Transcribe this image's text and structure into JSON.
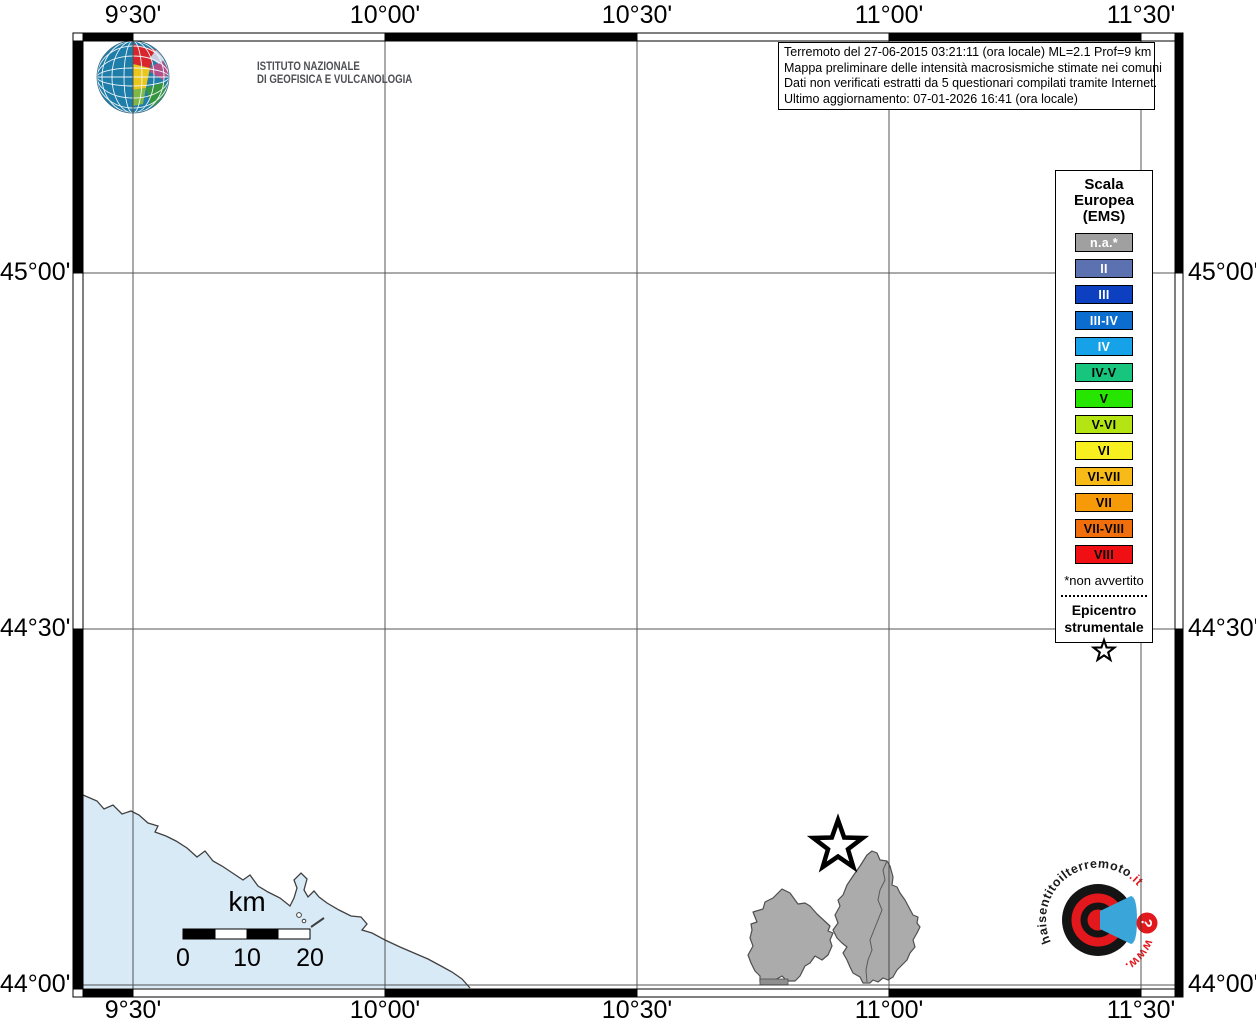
{
  "axes": {
    "top": [
      "9°30'",
      "10°00'",
      "10°30'",
      "11°00'",
      "11°30'"
    ],
    "bottom": [
      "9°30'",
      "10°00'",
      "10°30'",
      "11°00'",
      "11°30'"
    ],
    "left": [
      "45°00'",
      "44°30'",
      "44°00'"
    ],
    "right": [
      "45°00'",
      "44°30'",
      "44°00'"
    ]
  },
  "branding": {
    "org_line1": "ISTITUTO NAZIONALE",
    "org_line2": "DI GEOFISICA E VULCANOLOGIA"
  },
  "info_box": {
    "line1": "Terremoto del 27-06-2015 03:21:11 (ora locale) ML=2.1 Prof=9 km",
    "line2": "Mappa preliminare delle intensità macrosismiche stimate nei comuni",
    "line3": "Dati non verificati estratti da 5 questionari compilati tramite Internet.",
    "line4": "Ultimo aggiornamento: 07-01-2026 16:41 (ora locale)"
  },
  "legend": {
    "title_line1": "Scala",
    "title_line2": "Europea",
    "title_line3": "(EMS)",
    "items": [
      {
        "label": "n.a.*",
        "color": "#a0a0a0",
        "text_color": "#ffffff"
      },
      {
        "label": "II",
        "color": "#5c71b0",
        "text_color": "#ffffff"
      },
      {
        "label": "III",
        "color": "#0c40c0",
        "text_color": "#ffffff"
      },
      {
        "label": "III-IV",
        "color": "#0b6dce",
        "text_color": "#ffffff"
      },
      {
        "label": "IV",
        "color": "#16a2e8",
        "text_color": "#ffffff"
      },
      {
        "label": "IV-V",
        "color": "#17c57e",
        "text_color": "#000000"
      },
      {
        "label": "V",
        "color": "#26e600",
        "text_color": "#000000"
      },
      {
        "label": "V-VI",
        "color": "#b4e412",
        "text_color": "#000000"
      },
      {
        "label": "VI",
        "color": "#f7ef1f",
        "text_color": "#000000"
      },
      {
        "label": "VI-VII",
        "color": "#f8ba17",
        "text_color": "#000000"
      },
      {
        "label": "VII",
        "color": "#f79a08",
        "text_color": "#000000"
      },
      {
        "label": "VII-VIII",
        "color": "#f06e0c",
        "text_color": "#000000"
      },
      {
        "label": "VIII",
        "color": "#f01014",
        "text_color": "#000000"
      }
    ],
    "footnote": "*non avvertito",
    "epicenter_title_line1": "Epicentro",
    "epicenter_title_line2": "strumentale"
  },
  "scale_bar": {
    "unit_label": "km",
    "tick_labels": [
      "0",
      "10",
      "20"
    ]
  },
  "watermark": {
    "text": "haisentitoilterremoto",
    "suffix": ".it",
    "prefix": "www.",
    "question_mark": "?",
    "red": "#e2181d",
    "blue": "#3aa5d9"
  },
  "map": {
    "sea_color": "#d9eaf7",
    "municipality_color": "#ababab",
    "municipality_border": "#4f4f4f",
    "grid_color": "#383838"
  }
}
